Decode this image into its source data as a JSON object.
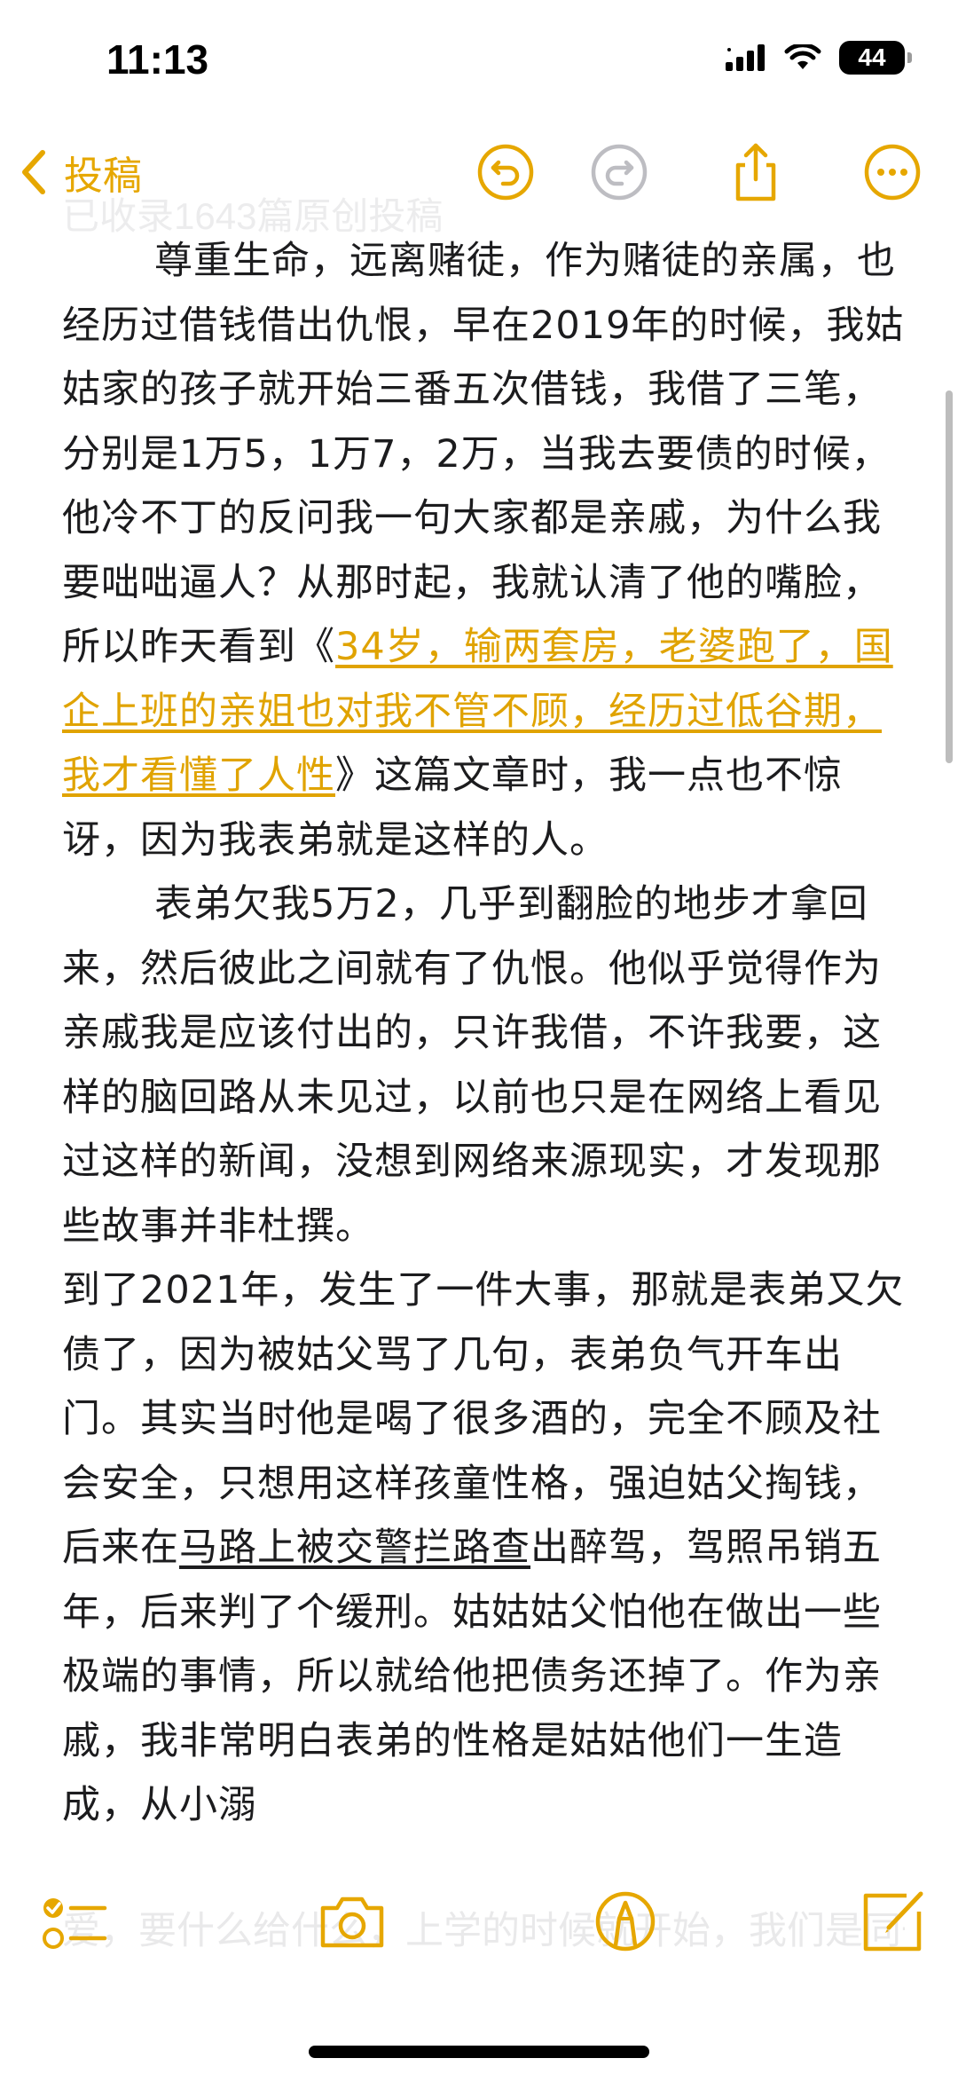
{
  "status_bar": {
    "time": "11:13",
    "battery": "44"
  },
  "nav": {
    "back_label": "投稿",
    "title_partial": "已收录1643篇原创投稿"
  },
  "accent_color": "#e6a700",
  "content": {
    "p1_before_link": "尊重生命，远离赌徒，作为赌徒的亲属，也经历过借钱借出仇恨，早在2019年的时候，我姑姑家的孩子就开始三番五次借钱，我借了三笔，分别是1万5，1万7，2万，当我去要债的时候，他冷不丁的反问我一句大家都是亲戚，为什么我要咄咄逼人？从那时起，我就认清了他的嘴脸，所以昨天看到《",
    "p1_link": "34岁，输两套房，老婆跑了，国企上班的亲姐也对我不管不顾，经历过低谷期，我才看懂了人性",
    "p1_after_link": "》这篇文章时，我一点也不惊讶，因为我表弟就是这样的人。",
    "p2": "表弟欠我5万2，几乎到翻脸的地步才拿回来，然后彼此之间就有了仇恨。他似乎觉得作为亲戚我是应该付出的，只许我借，不许我要，这样的脑回路从未见过，以前也只是在网络上看见过这样的新闻，没想到网络来源现实，才发现那些故事并非杜撰。",
    "p3_before_ul": "到了2021年，发生了一件大事，那就是表弟又欠债了，因为被姑父骂了几句，表弟负气开车出门。其实当时他是喝了很多酒的，完全不顾及社会安全，只想用这样孩童性格，强迫姑父掏钱，后来在",
    "p3_ul": "马路上被交警拦路查",
    "p3_after_ul": "出醉驾，驾照吊销五年，后来判了个缓刑。姑姑姑父怕他在做出一些极端的事情，所以就给他把债务还掉了。作为亲戚，我非常明白表弟的性格是姑姑他们一生造成，从小溺",
    "ghost_below": "爱，要什么给什么，上学的时候就开始，我们是同一所学校，他读初三，我才读初一，曾经就见过他跟别人借钱不还，要"
  },
  "toolbar": {
    "checklist": "checklist-icon",
    "camera": "camera-icon",
    "markup": "markup-pen-icon",
    "compose": "compose-icon"
  }
}
